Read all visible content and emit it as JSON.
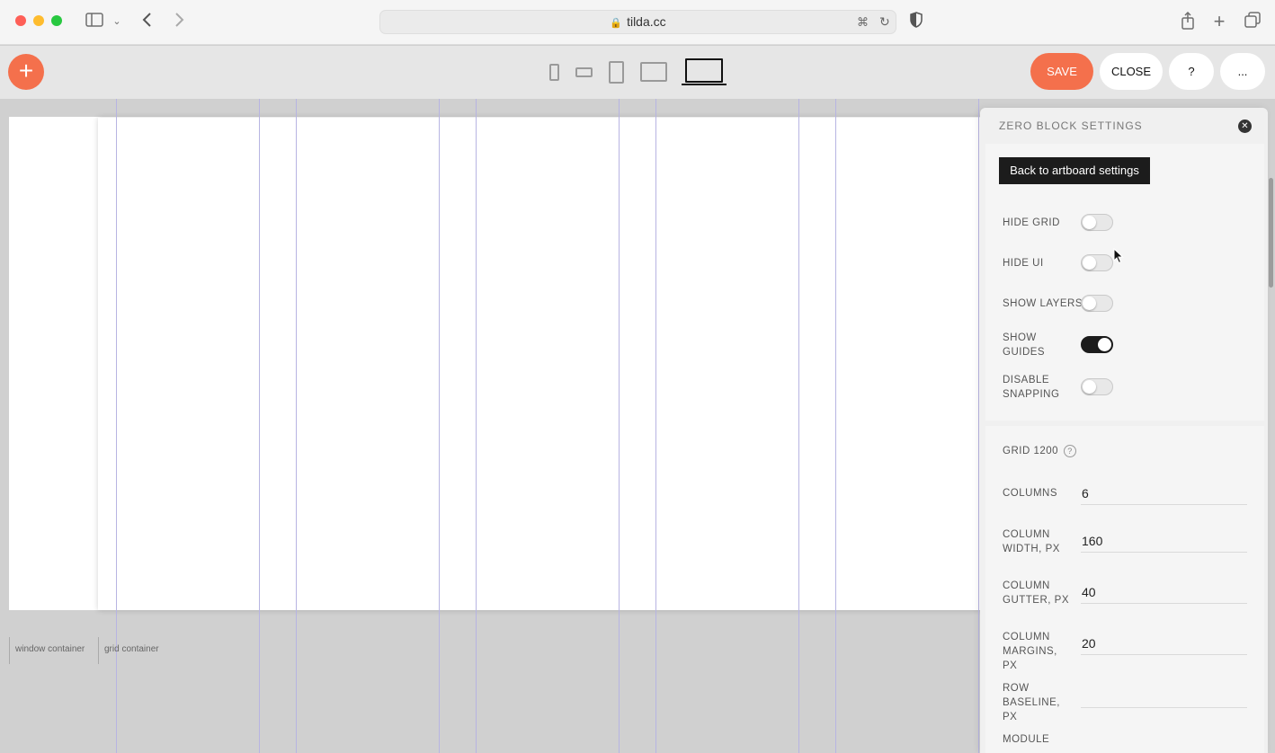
{
  "browser": {
    "url": "tilda.cc"
  },
  "toolbar": {
    "add_label": "+",
    "save_label": "SAVE",
    "close_label": "CLOSE",
    "help_label": "?",
    "more_label": "..."
  },
  "canvas": {
    "window_container_label": "window container",
    "grid_container_label": "grid container"
  },
  "panel": {
    "title": "ZERO BLOCK SETTINGS",
    "back_button": "Back to artboard settings",
    "toggles": [
      {
        "label": "HIDE GRID",
        "on": false
      },
      {
        "label": "HIDE UI",
        "on": false
      },
      {
        "label": "SHOW LAYERS",
        "on": false
      },
      {
        "label": "SHOW GUIDES",
        "on": true
      },
      {
        "label": "DISABLE SNAPPING",
        "on": false
      }
    ],
    "grid_title": "GRID 1200",
    "grid_help": "?",
    "fields": [
      {
        "label": "COLUMNS",
        "value": "6"
      },
      {
        "label": "COLUMN WIDTH, PX",
        "value": "160"
      },
      {
        "label": "COLUMN GUTTER, PX",
        "value": "40"
      },
      {
        "label": "COLUMN MARGINS, PX",
        "value": "20"
      },
      {
        "label": "ROW BASELINE, PX",
        "value": ""
      },
      {
        "label": "MODULE",
        "value": ""
      }
    ]
  }
}
